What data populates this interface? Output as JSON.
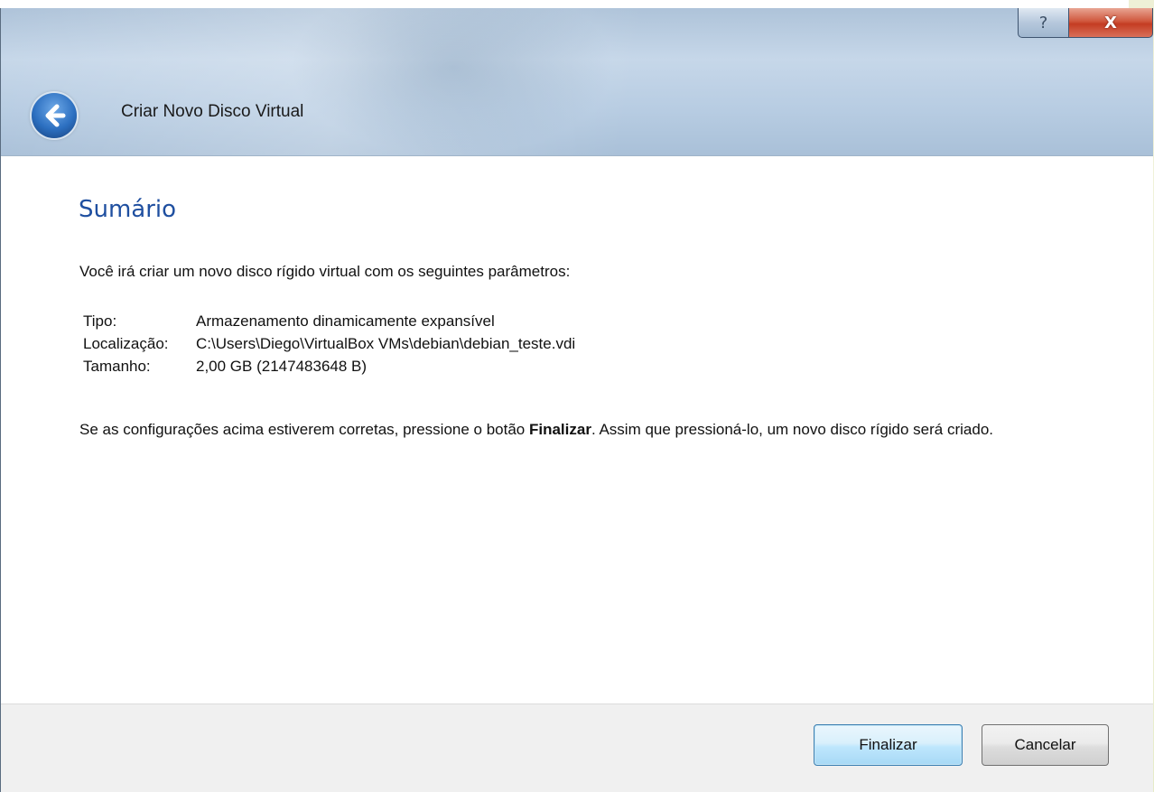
{
  "window": {
    "title": "Criar Novo Disco Virtual",
    "help_glyph": "?",
    "close_glyph": "X"
  },
  "page": {
    "heading": "Sumário",
    "intro": "Você irá criar um novo disco rígido virtual com os seguintes parâmetros:",
    "params": [
      {
        "key": "Tipo:",
        "value": "Armazenamento dinamicamente expansível"
      },
      {
        "key": "Localização:",
        "value": "C:\\Users\\Diego\\VirtualBox VMs\\debian\\debian_teste.vdi"
      },
      {
        "key": "Tamanho:",
        "value": "2,00 GB (2147483648 B)"
      }
    ],
    "note_before": "Se as configurações acima estiverem corretas, pressione o botão ",
    "note_bold": "Finalizar",
    "note_after": ". Assim que pressioná-lo, um novo disco rígido será criado."
  },
  "footer": {
    "finish_label": "Finalizar",
    "cancel_label": "Cancelar"
  },
  "icons": {
    "back": "back-arrow-icon",
    "help": "help-icon",
    "close": "close-icon"
  },
  "colors": {
    "heading": "#1f4fa0",
    "close_button": "#c43c22",
    "primary_button_border": "#3c7fb1"
  }
}
